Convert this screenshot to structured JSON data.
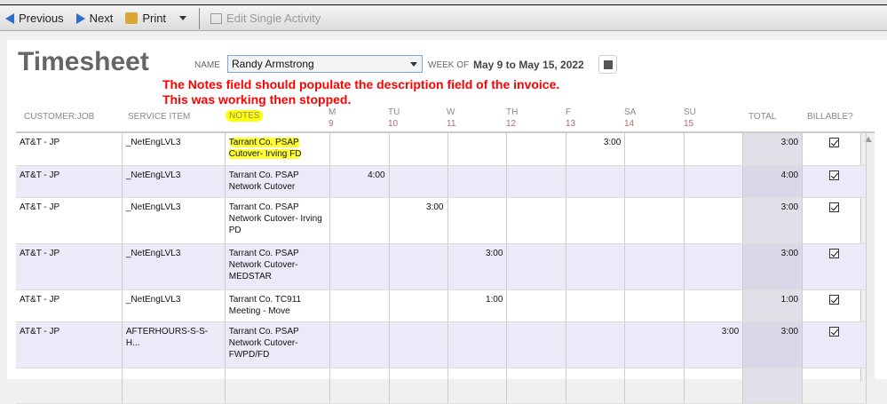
{
  "toolbar": {
    "previous": "Previous",
    "next": "Next",
    "print": "Print",
    "edit": "Edit Single Activity"
  },
  "page": {
    "title": "Timesheet",
    "name_label": "NAME",
    "name_value": "Randy Armstrong",
    "week_label": "WEEK OF",
    "week_value": "May 9 to May 15, 2022"
  },
  "annotation": {
    "line1": "The Notes field should populate the description field of the invoice.",
    "line2": "This was working then stopped."
  },
  "columns": {
    "customer": "CUSTOMER:JOB",
    "service": "SERVICE ITEM",
    "notes": "NOTES",
    "days": [
      {
        "d": "M",
        "n": "9"
      },
      {
        "d": "TU",
        "n": "10"
      },
      {
        "d": "W",
        "n": "11"
      },
      {
        "d": "TH",
        "n": "12"
      },
      {
        "d": "F",
        "n": "13"
      },
      {
        "d": "SA",
        "n": "14"
      },
      {
        "d": "SU",
        "n": "15"
      }
    ],
    "total": "TOTAL",
    "billable": "BILLABLE?"
  },
  "rows": [
    {
      "customer": "AT&T - JP",
      "service": "_NetEngLVL3",
      "notes": "Tarrant Co. PSAP Cutover- Irving FD",
      "hours": [
        "",
        "",
        "",
        "",
        "3:00",
        "",
        ""
      ],
      "total": "3:00",
      "billable": true
    },
    {
      "customer": "AT&T - JP",
      "service": "_NetEngLVL3",
      "notes": "Tarrant Co. PSAP Network Cutover",
      "hours": [
        "4:00",
        "",
        "",
        "",
        "",
        "",
        ""
      ],
      "total": "4:00",
      "billable": true
    },
    {
      "customer": "AT&T - JP",
      "service": "_NetEngLVL3",
      "notes": "Tarrant Co. PSAP Network Cutover- Irving PD",
      "hours": [
        "",
        "3:00",
        "",
        "",
        "",
        "",
        ""
      ],
      "total": "3:00",
      "billable": true
    },
    {
      "customer": "AT&T - JP",
      "service": "_NetEngLVL3",
      "notes": "Tarrant Co. PSAP Network Cutover- MEDSTAR",
      "hours": [
        "",
        "",
        "3:00",
        "",
        "",
        "",
        ""
      ],
      "total": "3:00",
      "billable": true
    },
    {
      "customer": "AT&T - JP",
      "service": "_NetEngLVL3",
      "notes": "Tarrant Co. TC911 Meeting - Move",
      "hours": [
        "",
        "",
        "1:00",
        "",
        "",
        "",
        ""
      ],
      "total": "1:00",
      "billable": true
    },
    {
      "customer": "AT&T - JP",
      "service": "AFTERHOURS-S-S-H...",
      "notes": "Tarrant Co. PSAP Network Cutover- FWPD/FD",
      "hours": [
        "",
        "",
        "",
        "",
        "",
        "",
        "3:00"
      ],
      "total": "3:00",
      "billable": true
    }
  ]
}
